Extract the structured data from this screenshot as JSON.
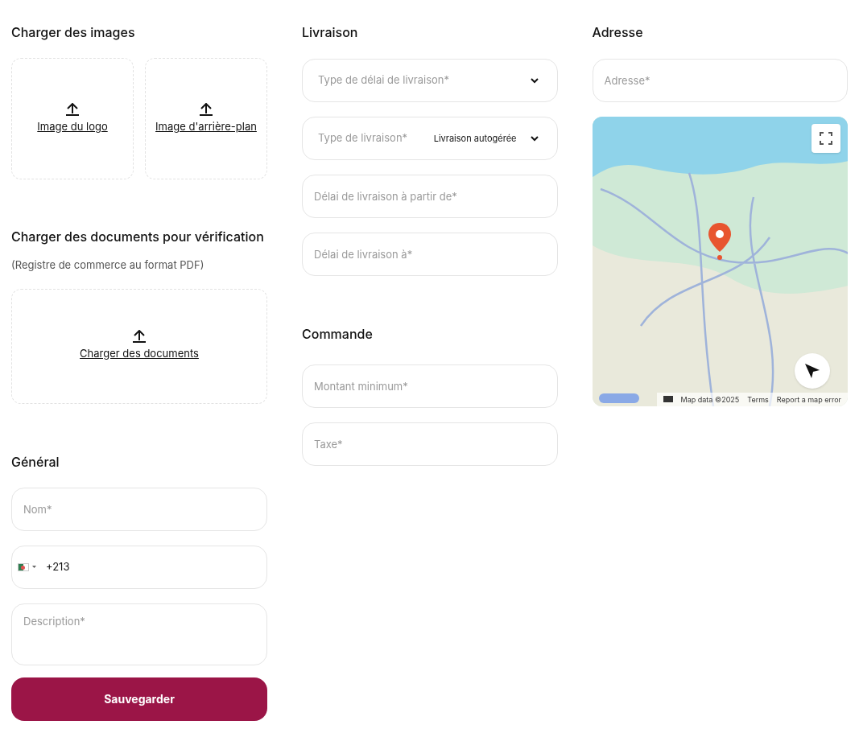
{
  "images": {
    "title": "Charger des images",
    "uploads": [
      {
        "label": "Image du logo"
      },
      {
        "label": "Image d'arrière-plan"
      }
    ]
  },
  "documents": {
    "title": "Charger des documents pour vérification",
    "hint": "(Registre de commerce au format PDF)",
    "upload": {
      "label": "Charger des documents"
    }
  },
  "general": {
    "title": "Général",
    "fields": [
      {
        "kind": "text",
        "placeholder": "Nom*"
      },
      {
        "kind": "phone",
        "value": "+213"
      },
      {
        "kind": "textarea",
        "placeholder": "Description*"
      }
    ],
    "save_button": "Sauvegarder"
  },
  "delivery": {
    "title": "Livraison",
    "fields": [
      {
        "kind": "select",
        "placeholder": "Type de délai de livraison*"
      },
      {
        "kind": "select",
        "placeholder": "Type de livraison*",
        "value": "Livraison autogérée"
      },
      {
        "kind": "text",
        "placeholder": "Délai de livraison à partir de*"
      },
      {
        "kind": "text",
        "placeholder": "Délai de livraison à*"
      }
    ]
  },
  "order": {
    "title": "Commande",
    "fields": [
      {
        "kind": "text",
        "placeholder": "Montant minimum*"
      },
      {
        "kind": "text",
        "placeholder": "Taxe*"
      }
    ]
  },
  "address": {
    "title": "Adresse",
    "field": {
      "placeholder": "Adresse*"
    },
    "map": {
      "attribution": [
        "Map data ©2025",
        "Terms",
        "Report a map error"
      ]
    }
  }
}
